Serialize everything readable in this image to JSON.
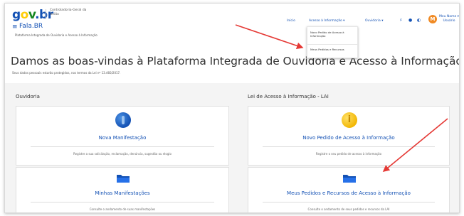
{
  "header": {
    "logo": "gov.br",
    "org": "Controladoria-Geral da União",
    "menu_glyph": "≡",
    "app_title": "Fala.BR",
    "app_subtitle": "Plataforma Integrada de Ouvidoria e Acesso à Informação"
  },
  "nav": {
    "inicio": "Início",
    "acesso": "Acesso à Informação ▾",
    "ouvidoria": "Ouvidoria ▾",
    "icons": [
      "contrast-icon",
      "dot-icon",
      "half-circle-icon"
    ],
    "avatar_initial": "M",
    "user_name": "Meu Nome ▾",
    "user_role": "Usuário"
  },
  "dropdown": {
    "items": [
      "Novo Pedido de Acesso à Informação",
      "Meus Pedidos e Recursos"
    ]
  },
  "hero": {
    "title": "Damos as boas-vindas à Plataforma Integrada de Ouvidoria e Acesso à Informação",
    "subtitle": "Seus dados pessoais estarão protegidos, nos termos da Lei nº 13.460/2017."
  },
  "left_column": {
    "heading": "Ouvidoria",
    "cards": [
      {
        "title": "Nova Manifestação",
        "description": "Registre a sua solicitação, reclamação, denúncia, sugestão ou elogio",
        "icon": "info-circle-icon"
      },
      {
        "title": "Minhas Manifestações",
        "description": "Consulte o andamento de suas manifestações",
        "icon": "folder-icon"
      }
    ]
  },
  "right_column": {
    "heading": "Lei de Acesso à Informação - LAI",
    "cards": [
      {
        "title": "Novo Pedido de Acesso à Informação",
        "description": "Registre o seu pedido de acesso à informação",
        "icon": "info-yellow-icon",
        "icon_glyph": "i"
      },
      {
        "title": "Meus Pedidos e Recursos de Acesso à Informação",
        "description": "Consulte o andamento de seus pedidos e recursos da LAI",
        "icon": "folder-icon"
      }
    ]
  },
  "colors": {
    "primary_blue": "#1351b4",
    "arrow_red": "#e53935",
    "avatar_orange": "#f08a24",
    "background_gray": "#f4f4f4"
  }
}
